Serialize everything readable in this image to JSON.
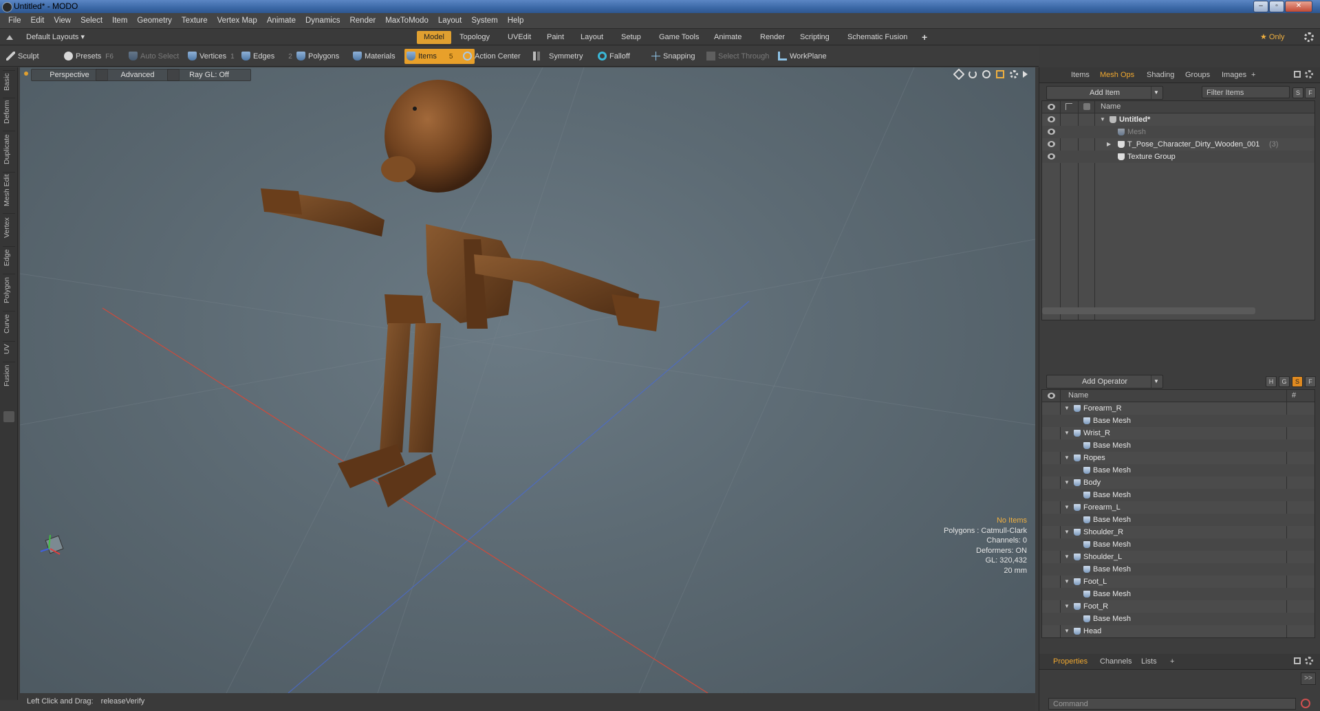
{
  "window": {
    "title": "Untitled* - MODO",
    "buttons": [
      "–",
      "▫",
      "✕"
    ]
  },
  "menu": [
    "File",
    "Edit",
    "View",
    "Select",
    "Item",
    "Geometry",
    "Texture",
    "Vertex Map",
    "Animate",
    "Dynamics",
    "Render",
    "MaxToModo",
    "Layout",
    "System",
    "Help"
  ],
  "layout_bar": {
    "layout_menu": "Default Layouts ▾",
    "tabs": [
      "Model",
      "Topology",
      "UVEdit",
      "Paint",
      "Layout",
      "Setup",
      "Game Tools",
      "Animate",
      "Render",
      "Scripting",
      "Schematic Fusion"
    ],
    "active_tab": "Model",
    "add_tab": "+",
    "only_label": "★ Only"
  },
  "toolbar": {
    "sculpt": "Sculpt",
    "presets": "Presets",
    "presets_key": "F6",
    "auto_select": "Auto Select",
    "vertices": "Vertices",
    "vertices_key": "1",
    "edges": "Edges",
    "edges_key": "2",
    "polygons": "Polygons",
    "materials": "Materials",
    "items": "Items",
    "items_key": "5",
    "action_center": "Action Center",
    "symmetry": "Symmetry",
    "falloff": "Falloff",
    "snapping": "Snapping",
    "select_through": "Select Through",
    "workplane": "WorkPlane"
  },
  "left_tabs": [
    "Basic",
    "Deform",
    "Duplicate",
    "Mesh Edit",
    "Vertex",
    "Edge",
    "Polygon",
    "Curve",
    "UV",
    "Fusion"
  ],
  "viewport": {
    "view": "Perspective",
    "shading": "Advanced",
    "raygl": "Ray GL: Off",
    "info": {
      "selection": "No Items",
      "polygons": "Polygons : Catmull-Clark",
      "channels": "Channels: 0",
      "deformers": "Deformers: ON",
      "gl": "GL: 320,432",
      "scale": "20 mm"
    }
  },
  "status": {
    "hint": "Left Click and Drag:",
    "command": "releaseVerify"
  },
  "right_panel": {
    "tabs": [
      "Items",
      "Mesh Ops",
      "Shading",
      "Groups",
      "Images",
      "+"
    ],
    "active_tab": "Mesh Ops",
    "add_item": "Add Item",
    "filter_placeholder": "Filter Items",
    "filter_s": "S",
    "filter_f": "F",
    "item_col": "Name",
    "items": [
      {
        "label": "Untitled*",
        "count": "",
        "level": 0,
        "bold": true,
        "expand": "▼"
      },
      {
        "label": "Mesh",
        "count": "",
        "level": 1,
        "dim": true,
        "expand": ""
      },
      {
        "label": "T_Pose_Character_Dirty_Wooden_001",
        "count": "(3)",
        "level": 1,
        "expand": "▶"
      },
      {
        "label": "Texture Group",
        "count": "",
        "level": 1,
        "expand": ""
      }
    ],
    "add_operator": "Add Operator",
    "op_buttons": [
      "H",
      "G",
      "S",
      "F"
    ],
    "op_col": "Name",
    "op_col_hash": "#",
    "operators": [
      {
        "label": "Forearm_R",
        "child": "Base Mesh"
      },
      {
        "label": "Wrist_R",
        "child": "Base Mesh"
      },
      {
        "label": "Ropes",
        "child": "Base Mesh"
      },
      {
        "label": "Body",
        "child": "Base Mesh"
      },
      {
        "label": "Forearm_L",
        "child": "Base Mesh"
      },
      {
        "label": "Shoulder_R",
        "child": "Base Mesh"
      },
      {
        "label": "Shoulder_L",
        "child": "Base Mesh"
      },
      {
        "label": "Foot_L",
        "child": "Base Mesh"
      },
      {
        "label": "Foot_R",
        "child": "Base Mesh"
      },
      {
        "label": "Head",
        "child": ""
      }
    ],
    "bottom_tabs": [
      "Properties",
      "Channels",
      "Lists",
      "+"
    ],
    "bottom_active": "Properties",
    "command_placeholder": "Command",
    "expand_btn": ">>"
  },
  "colors": {
    "accent": "#e8a02a",
    "wood": "#7a4a22"
  }
}
